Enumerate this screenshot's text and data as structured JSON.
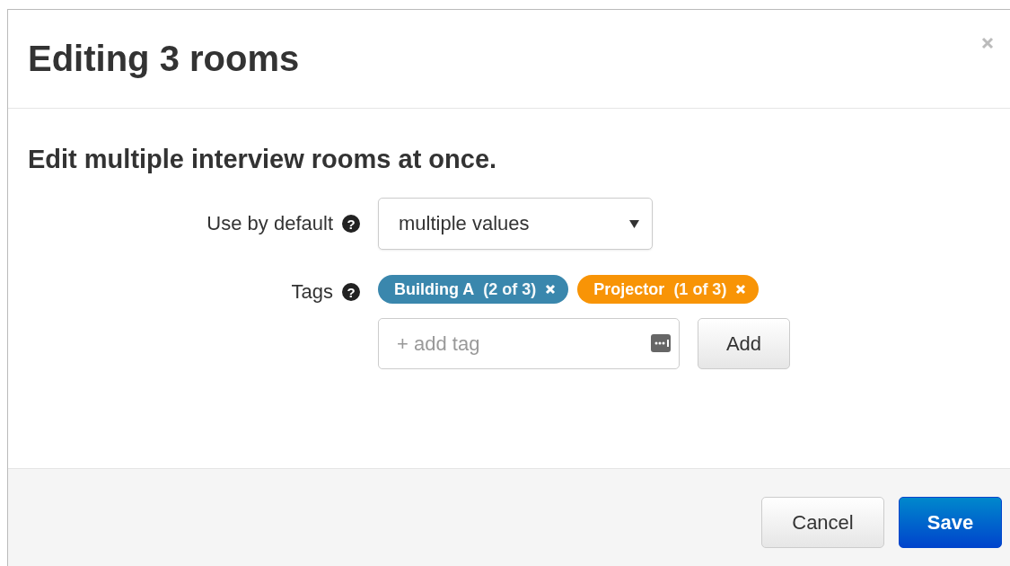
{
  "dialog": {
    "title": "Editing 3 rooms",
    "subtitle": "Edit multiple interview rooms at once."
  },
  "fields": [
    {
      "kind": "select",
      "label": "Use by default",
      "help": "?",
      "value": "multiple values"
    },
    {
      "kind": "tags",
      "label": "Tags",
      "help": "?",
      "tags": [
        {
          "name": "Building A",
          "count": "(2 of 3)",
          "color": "#3a87ad"
        },
        {
          "name": "Projector",
          "count": "(1 of 3)",
          "color": "#f89406"
        }
      ],
      "placeholder": "+ add tag",
      "add_button": "Add"
    }
  ],
  "buttons": [
    {
      "label": "Cancel",
      "kind": "default"
    },
    {
      "label": "Save",
      "kind": "primary"
    }
  ]
}
